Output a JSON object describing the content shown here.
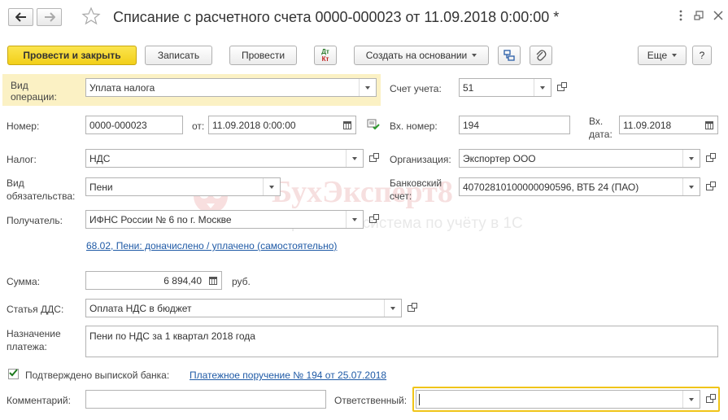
{
  "window": {
    "title": "Списание с расчетного счета 0000-000023 от 11.09.2018 0:00:00 *"
  },
  "toolbar": {
    "post_close": "Провести и закрыть",
    "save": "Записать",
    "post": "Провести",
    "dtkt_top": "Дт",
    "dtkt_bottom": "Кт",
    "create_based": "Создать на основании",
    "more": "Еще",
    "help": "?"
  },
  "form": {
    "operation_type": {
      "label_1": "Вид",
      "label_2": "операции:",
      "value": "Уплата налога"
    },
    "account": {
      "label": "Счет учета:",
      "value": "51"
    },
    "number": {
      "label": "Номер:",
      "value": "0000-000023"
    },
    "date": {
      "label": "от:",
      "value": "11.09.2018  0:00:00"
    },
    "in_number": {
      "label": "Вх. номер:",
      "value": "194"
    },
    "in_date": {
      "label_1": "Вх.",
      "label_2": "дата:",
      "value": "11.09.2018"
    },
    "tax": {
      "label": "Налог:",
      "value": "НДС"
    },
    "organization": {
      "label": "Организация:",
      "value": "Экспортер ООО"
    },
    "obligation": {
      "label_1": "Вид",
      "label_2": "обязательства:",
      "value": "Пени"
    },
    "bank_account": {
      "label_1": "Банковский",
      "label_2": "счет:",
      "value": "40702810100000090596, ВТБ 24 (ПАО)"
    },
    "recipient": {
      "label": "Получатель:",
      "value": "ИФНС России № 6 по г. Москве"
    },
    "accounting_link": "68.02, Пени: доначислено / уплачено (самостоятельно)",
    "amount": {
      "label": "Сумма:",
      "value": "6 894,40",
      "unit": "руб."
    },
    "dds": {
      "label": "Статья ДДС:",
      "value": "Оплата НДС в бюджет"
    },
    "purpose": {
      "label_1": "Назначение",
      "label_2": "платежа:",
      "value": "Пени по НДС за 1 квартал 2018 года"
    },
    "confirmed": {
      "label": "Подтверждено выпиской банка:",
      "checked": true
    },
    "payment_order_link": "Платежное поручение № 194 от 25.07.2018",
    "comment": {
      "label": "Комментарий:",
      "value": ""
    },
    "responsible": {
      "label": "Ответственный:",
      "value": ""
    }
  },
  "watermark": {
    "brand": "БухЭксперт8",
    "tagline": "Справочная система по учёту в 1С"
  },
  "colors": {
    "primary_button": "#f5d51f",
    "highlight": "#fbf1c4",
    "link": "#1f5aa6",
    "active_border": "#f0c419"
  }
}
